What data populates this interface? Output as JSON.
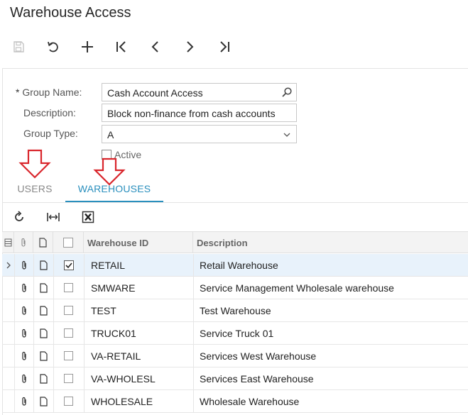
{
  "header": {
    "title": "Warehouse Access"
  },
  "toolbar": {
    "buttons": [
      "save-icon",
      "undo-icon",
      "add-icon",
      "first-record-icon",
      "previous-record-icon",
      "next-record-icon",
      "last-record-icon"
    ]
  },
  "form": {
    "group_name": {
      "required_mark": "*",
      "label": "Group Name:",
      "value": "Cash Account Access"
    },
    "description": {
      "label": "Description:",
      "value": "Block non-finance from cash accounts"
    },
    "group_type": {
      "label": "Group Type:",
      "value": "A"
    },
    "active": {
      "label": "Active",
      "checked": false
    }
  },
  "tabs": [
    {
      "label": "USERS",
      "active": false
    },
    {
      "label": "WAREHOUSES",
      "active": true
    }
  ],
  "grid_toolbar": {
    "buttons": [
      "refresh-icon",
      "fit-columns-icon",
      "export-excel-icon"
    ]
  },
  "grid": {
    "columns": [
      "Warehouse ID",
      "Description"
    ],
    "rows": [
      {
        "id": "RETAIL",
        "description": "Retail Warehouse",
        "included": true,
        "selected": true
      },
      {
        "id": "SMWARE",
        "description": "Service Management Wholesale warehouse",
        "included": false,
        "selected": false
      },
      {
        "id": "TEST",
        "description": "Test Warehouse",
        "included": false,
        "selected": false
      },
      {
        "id": "TRUCK01",
        "description": "Service Truck 01",
        "included": false,
        "selected": false
      },
      {
        "id": "VA-RETAIL",
        "description": "Services West Warehouse",
        "included": false,
        "selected": false
      },
      {
        "id": "VA-WHOLESL",
        "description": "Services East Warehouse",
        "included": false,
        "selected": false
      },
      {
        "id": "WHOLESALE",
        "description": "Wholesale Warehouse",
        "included": false,
        "selected": false
      }
    ]
  },
  "colors": {
    "accent": "#2a8fbd",
    "annotation_arrow": "#d9262c",
    "selected_row": "#e8f2fb"
  }
}
